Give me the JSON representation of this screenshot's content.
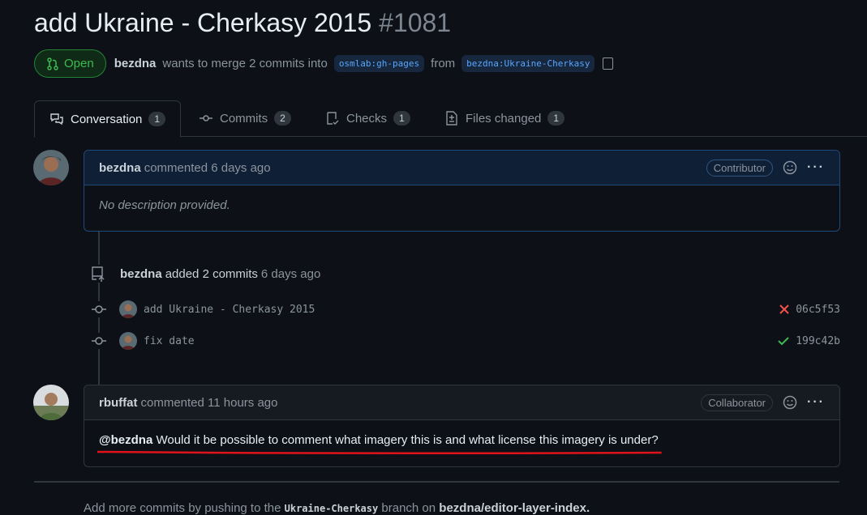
{
  "pr": {
    "title": "add Ukraine - Cherkasy 2015",
    "number": "#1081",
    "status": "Open",
    "author": "bezdna",
    "merge_text": "wants to merge 2 commits into",
    "base_branch": "osmlab:gh-pages",
    "from_text": "from",
    "head_branch": "bezdna:Ukraine-Cherkasy"
  },
  "tabs": [
    {
      "label": "Conversation",
      "count": "1"
    },
    {
      "label": "Commits",
      "count": "2"
    },
    {
      "label": "Checks",
      "count": "1"
    },
    {
      "label": "Files changed",
      "count": "1"
    }
  ],
  "first_comment": {
    "author": "bezdna",
    "time": "commented 6 days ago",
    "role": "Contributor",
    "body": "No description provided."
  },
  "commit_event": {
    "author": "bezdna",
    "text": "added 2 commits",
    "time": "6 days ago"
  },
  "commits": [
    {
      "message": "add Ukraine - Cherkasy 2015",
      "sha": "06c5f53",
      "status": "fail"
    },
    {
      "message": "fix date",
      "sha": "199c42b",
      "status": "success"
    }
  ],
  "second_comment": {
    "author": "rbuffat",
    "time": "commented 11 hours ago",
    "role": "Collaborator",
    "mention": "@bezdna",
    "body": "Would it be possible to comment what imagery this is and what license this imagery is under?"
  },
  "footer": {
    "prefix": "Add more commits by pushing to the",
    "branch": "Ukraine-Cherkasy",
    "middle": "branch on",
    "repo": "bezdna/editor-layer-index."
  },
  "colors": {
    "background": "#0d1117",
    "open_green": "#3fb950",
    "link_blue": "#58a6ff",
    "fail_red": "#f85149",
    "underline_red": "#e0131a"
  }
}
